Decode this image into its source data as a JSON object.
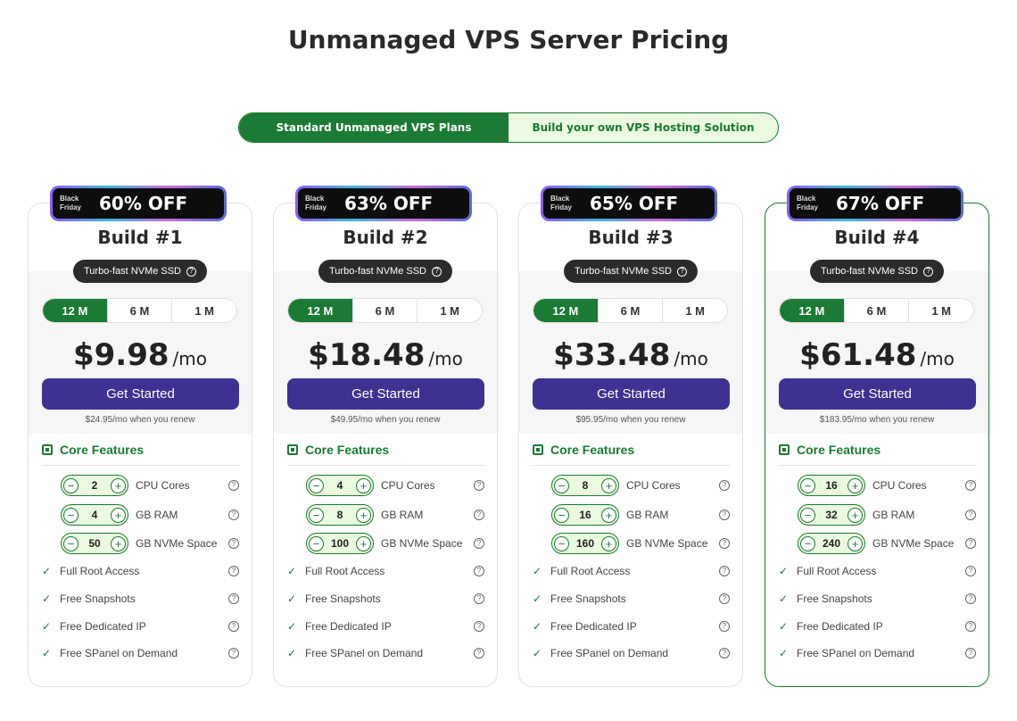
{
  "page": {
    "title": "Unmanaged VPS Server Pricing"
  },
  "toggle": {
    "standard": "Standard Unmanaged VPS Plans",
    "build_own": "Build your own VPS Hosting Solution"
  },
  "badge_label": "Black Friday",
  "ssd_label": "Turbo-fast NVMe SSD",
  "periods": [
    "12 M",
    "6 M",
    "1 M"
  ],
  "price_unit": "/mo",
  "cta_label": "Get Started",
  "features_title": "Core Features",
  "spec_labels": [
    "CPU Cores",
    "GB RAM",
    "GB NVMe Space"
  ],
  "feature_list": [
    "Full Root Access",
    "Free Snapshots",
    "Free Dedicated IP",
    "Free SPanel on Demand"
  ],
  "colors": {
    "brand_green": "#1b7a33",
    "light_green": "#eaf9df",
    "cta_purple": "#3d3191",
    "badge_black": "#0d0d0d"
  },
  "plans": [
    {
      "discount": "60% OFF",
      "name": "Build #1",
      "price": "$9.98",
      "renew": "$24.95/mo when you renew",
      "cpu": "2",
      "ram": "4",
      "nvme": "50"
    },
    {
      "discount": "63% OFF",
      "name": "Build #2",
      "price": "$18.48",
      "renew": "$49.95/mo when you renew",
      "cpu": "4",
      "ram": "8",
      "nvme": "100"
    },
    {
      "discount": "65% OFF",
      "name": "Build #3",
      "price": "$33.48",
      "renew": "$95.95/mo when you renew",
      "cpu": "8",
      "ram": "16",
      "nvme": "160"
    },
    {
      "discount": "67% OFF",
      "name": "Build #4",
      "price": "$61.48",
      "renew": "$183.95/mo when you renew",
      "cpu": "16",
      "ram": "32",
      "nvme": "240"
    }
  ]
}
